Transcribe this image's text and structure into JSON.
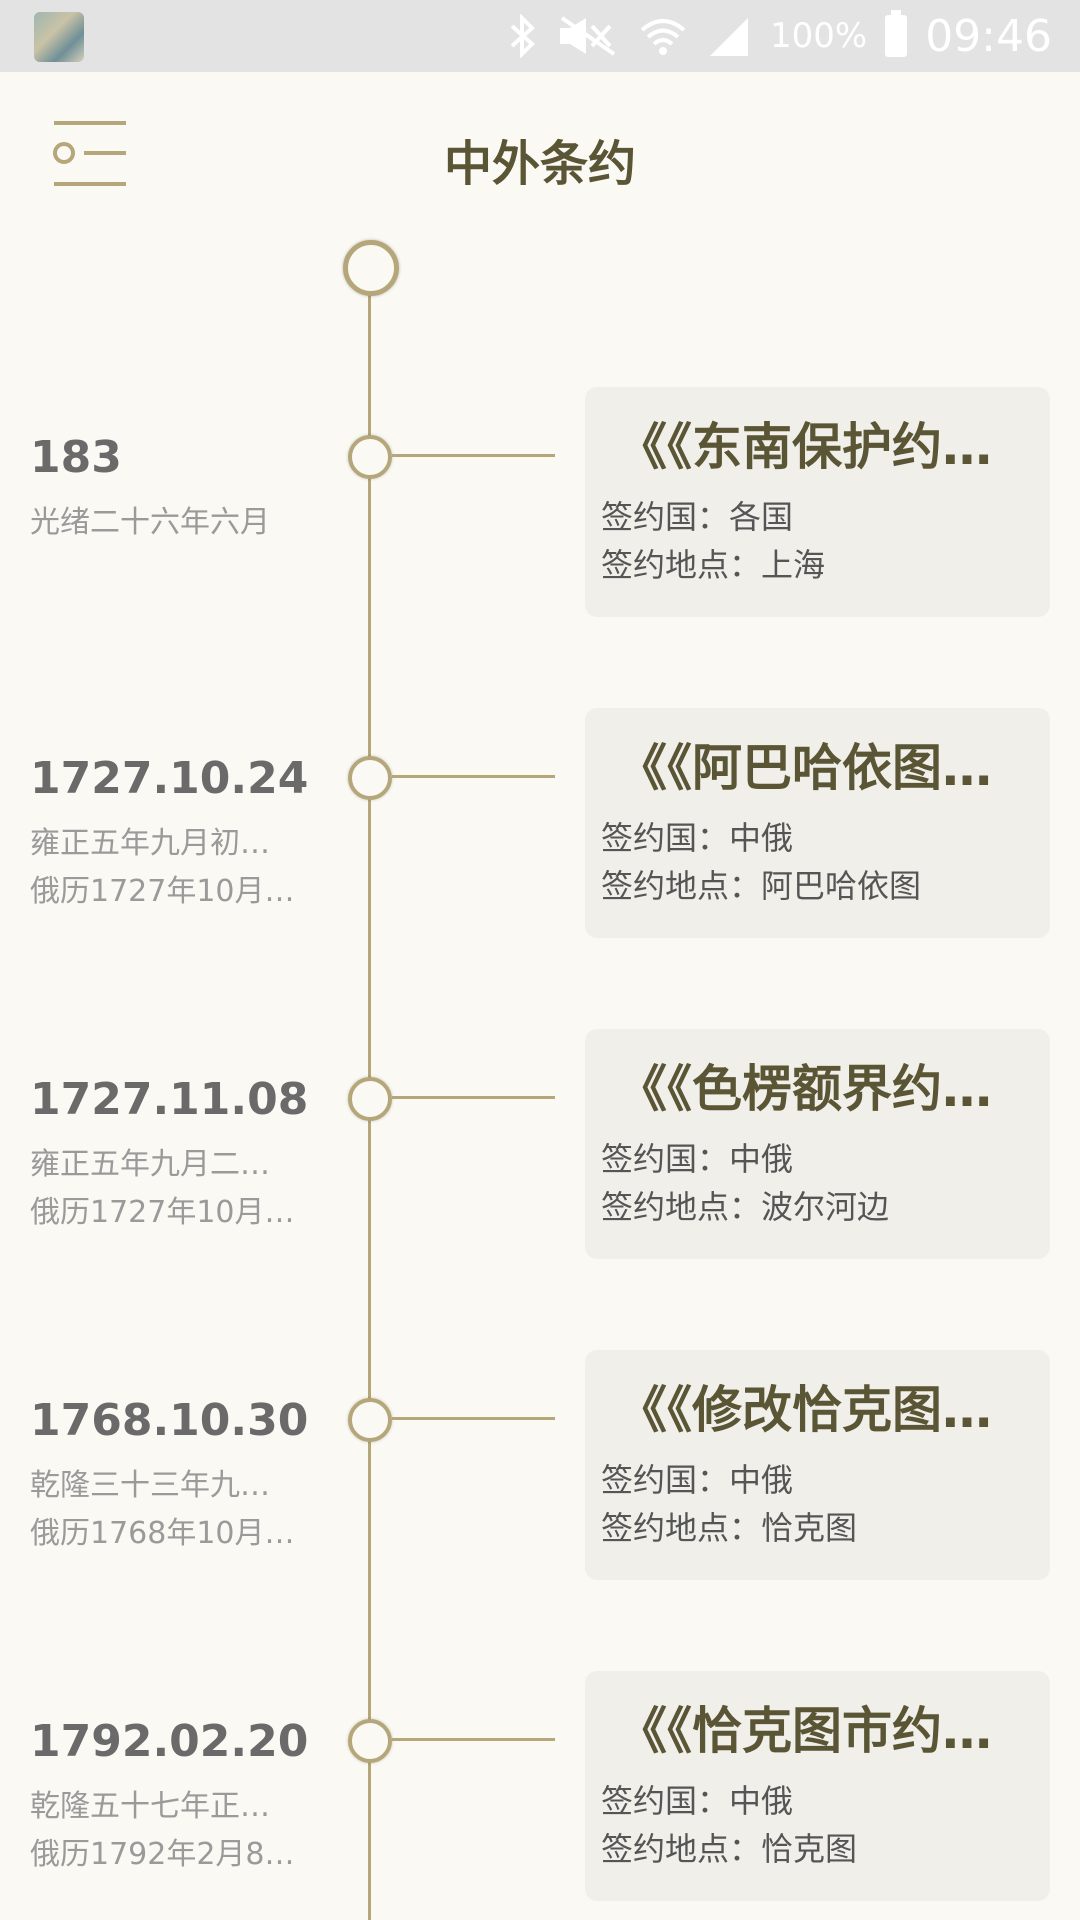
{
  "status_bar": {
    "battery": "100%",
    "time": "09:46",
    "icons": [
      "bluetooth-icon",
      "mute-icon",
      "wifi-icon",
      "signal-icon",
      "battery-icon"
    ]
  },
  "header": {
    "title": "中外条约",
    "menu_icon": "menu-icon"
  },
  "colors": {
    "background": "#fbf9f3",
    "accent": "#b5a77a",
    "title": "#5a5535",
    "card": "#f0efea"
  },
  "items": [
    {
      "date": "183",
      "sub1": "光绪二十六年六月",
      "sub2": "",
      "title": "《《东南保护约…",
      "country": "签约国：各国",
      "place": "签约地点：上海"
    },
    {
      "date": "1727.10.24",
      "sub1": "雍正五年九月初…",
      "sub2": "俄历1727年10月…",
      "title": "《《阿巴哈依图…",
      "country": "签约国：中俄",
      "place": "签约地点：阿巴哈依图"
    },
    {
      "date": "1727.11.08",
      "sub1": "雍正五年九月二…",
      "sub2": "俄历1727年10月…",
      "title": "《《色楞额界约…",
      "country": "签约国：中俄",
      "place": "签约地点：波尔河边"
    },
    {
      "date": "1768.10.30",
      "sub1": "乾隆三十三年九…",
      "sub2": "俄历1768年10月…",
      "title": "《《修改恰克图…",
      "country": "签约国：中俄",
      "place": "签约地点：恰克图"
    },
    {
      "date": "1792.02.20",
      "sub1": "乾隆五十七年正…",
      "sub2": "俄历1792年2月8…",
      "title": "《《恰克图市约…",
      "country": "签约国：中俄",
      "place": "签约地点：恰克图"
    }
  ]
}
